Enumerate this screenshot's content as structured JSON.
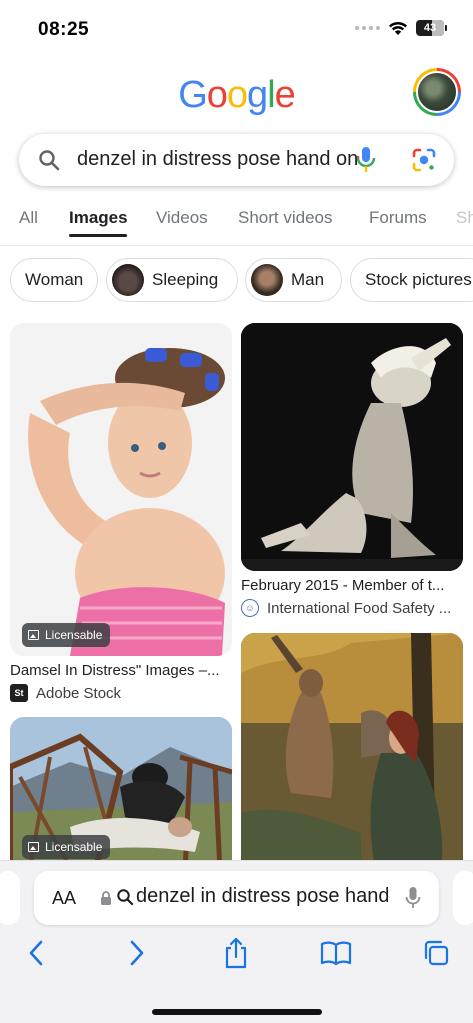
{
  "status_bar": {
    "time": "08:25",
    "battery": "43",
    "icons": [
      "signal-icon",
      "wifi-icon",
      "battery-icon"
    ]
  },
  "header": {
    "logo": "Google",
    "search_query": "denzel in distress pose hand on forehead",
    "icons": [
      "search-icon",
      "mic-icon",
      "lens-icon"
    ]
  },
  "tabs": [
    {
      "label": "All",
      "active": false
    },
    {
      "label": "Images",
      "active": true
    },
    {
      "label": "Videos",
      "active": false
    },
    {
      "label": "Short videos",
      "active": false
    },
    {
      "label": "Forums",
      "active": false
    },
    {
      "label": "Sh",
      "active": false
    }
  ],
  "chips": [
    {
      "label": "Woman"
    },
    {
      "label": "Sleeping"
    },
    {
      "label": "Man"
    },
    {
      "label": "Stock pictures"
    }
  ],
  "results": [
    {
      "title": "Damsel In Distress\" Images –...",
      "source": "Adobe Stock",
      "badge": "Licensable"
    },
    {
      "title": "February 2015 - Member of t...",
      "source": "International Food Safety ...",
      "badge": ""
    },
    {
      "title": "",
      "source": "",
      "badge": "Licensable"
    },
    {
      "title": "",
      "source": "",
      "badge": ""
    }
  ],
  "safari": {
    "aa_label": "AA",
    "address_text": "denzel in distress pose hand on forehead",
    "icons": [
      "back-icon",
      "forward-icon",
      "share-icon",
      "bookmarks-icon",
      "tabs-icon"
    ]
  }
}
